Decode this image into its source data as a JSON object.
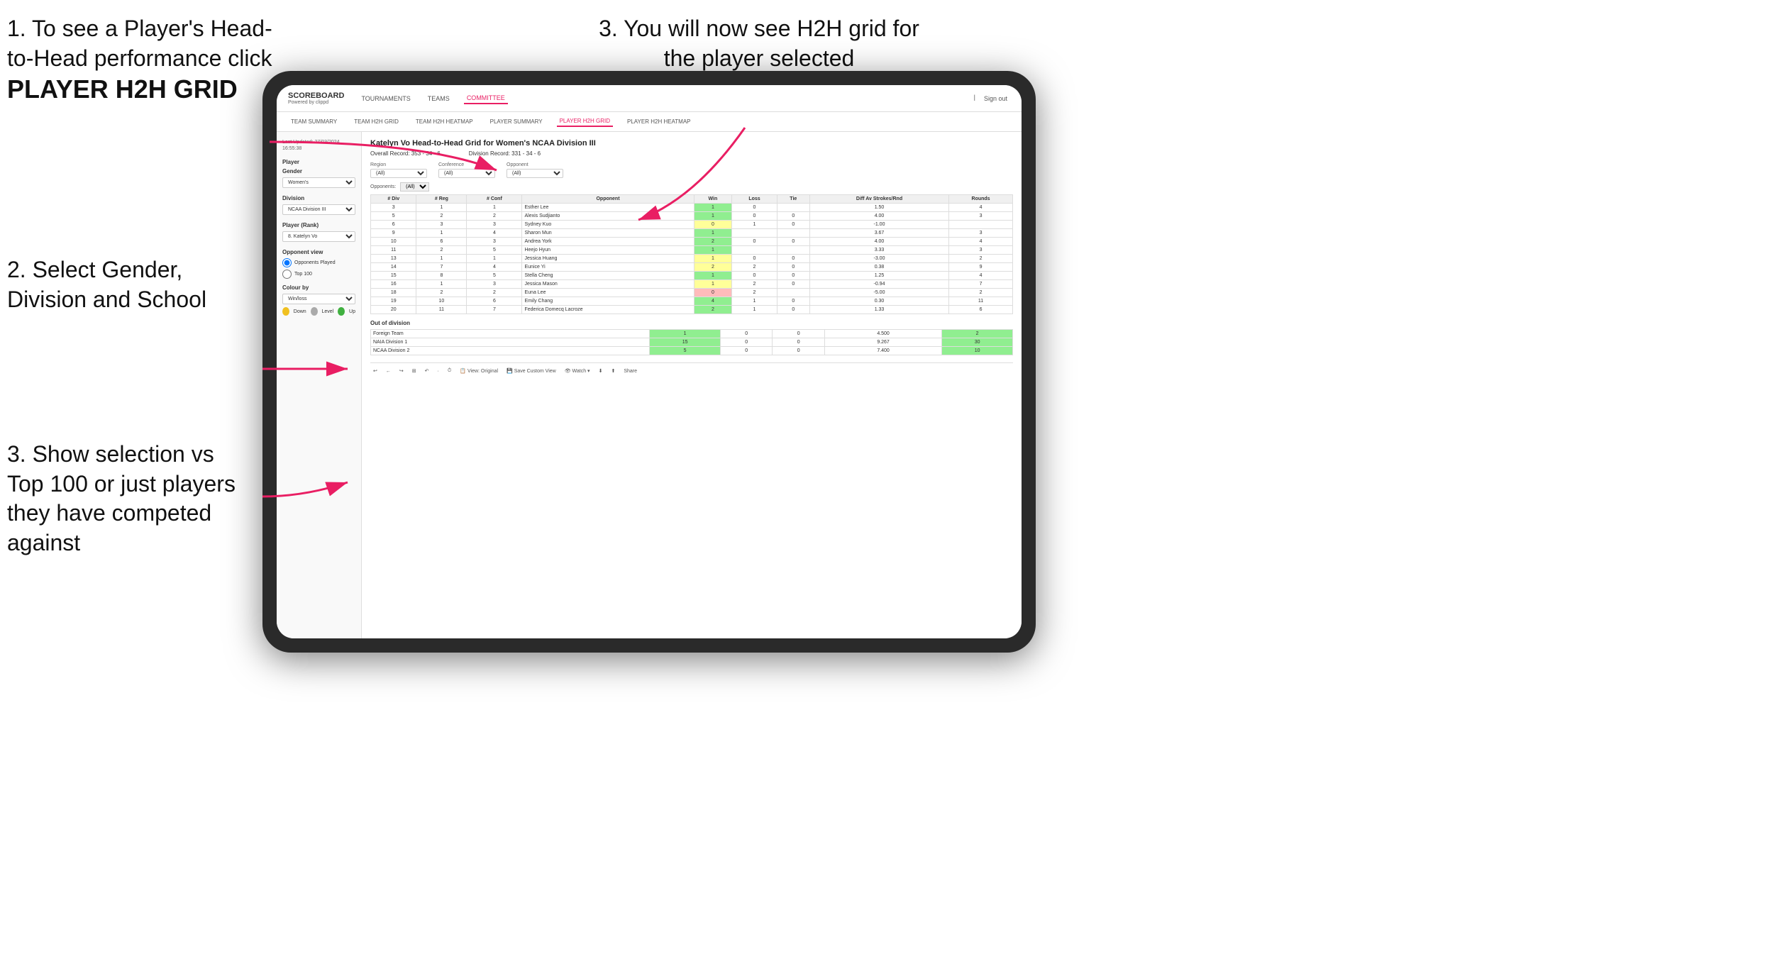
{
  "instructions": {
    "step1_title": "1. To see a Player's Head-to-Head performance click",
    "step1_bold": "PLAYER H2H GRID",
    "step2": "2. Select Gender, Division and School",
    "step3_top": "3. You will now see H2H grid for the player selected",
    "step3_bottom": "3. Show selection vs Top 100 or just players they have competed against"
  },
  "nav": {
    "logo": "SCOREBOARD",
    "logo_sub": "Powered by clippd",
    "links": [
      "TOURNAMENTS",
      "TEAMS",
      "COMMITTEE"
    ],
    "sign_out": "Sign out"
  },
  "sub_nav": {
    "links": [
      "TEAM SUMMARY",
      "TEAM H2H GRID",
      "TEAM H2H HEATMAP",
      "PLAYER SUMMARY",
      "PLAYER H2H GRID",
      "PLAYER H2H HEATMAP"
    ]
  },
  "sidebar": {
    "timestamp": "Last Updated: 27/03/2024\n16:55:38",
    "player_label": "Player",
    "gender_label": "Gender",
    "gender_value": "Women's",
    "division_label": "Division",
    "division_value": "NCAA Division III",
    "player_rank_label": "Player (Rank)",
    "player_rank_value": "8. Katelyn Vo",
    "opponent_view_label": "Opponent view",
    "opponent_options": [
      "Opponents Played",
      "Top 100"
    ],
    "colour_label": "Colour by",
    "colour_value": "Win/loss",
    "colour_dots": [
      {
        "color": "#f0c020",
        "label": "Down"
      },
      {
        "color": "#aaaaaa",
        "label": "Level"
      },
      {
        "color": "#40b040",
        "label": "Up"
      }
    ]
  },
  "grid": {
    "title": "Katelyn Vo Head-to-Head Grid for Women's NCAA Division III",
    "overall_record": "Overall Record: 353 - 34 - 6",
    "division_record": "Division Record: 331 - 34 - 6",
    "region_label": "Region",
    "conference_label": "Conference",
    "opponent_label": "Opponent",
    "opponents_label": "Opponents:",
    "filter_all": "(All)",
    "columns": [
      "# Div",
      "# Reg",
      "# Conf",
      "Opponent",
      "Win",
      "Loss",
      "Tie",
      "Diff Av Strokes/Rnd",
      "Rounds"
    ],
    "rows": [
      {
        "div": "3",
        "reg": "1",
        "conf": "1",
        "opponent": "Esther Lee",
        "win": "1",
        "loss": "0",
        "tie": "",
        "diff": "1.50",
        "rounds": "4",
        "win_color": "green"
      },
      {
        "div": "5",
        "reg": "2",
        "conf": "2",
        "opponent": "Alexis Sudjianto",
        "win": "1",
        "loss": "0",
        "tie": "0",
        "diff": "4.00",
        "rounds": "3",
        "win_color": "green"
      },
      {
        "div": "6",
        "reg": "3",
        "conf": "3",
        "opponent": "Sydney Kuo",
        "win": "0",
        "loss": "1",
        "tie": "0",
        "diff": "-1.00",
        "rounds": "",
        "win_color": "yellow"
      },
      {
        "div": "9",
        "reg": "1",
        "conf": "4",
        "opponent": "Sharon Mun",
        "win": "1",
        "loss": "",
        "tie": "",
        "diff": "3.67",
        "rounds": "3",
        "win_color": "green"
      },
      {
        "div": "10",
        "reg": "6",
        "conf": "3",
        "opponent": "Andrea York",
        "win": "2",
        "loss": "0",
        "tie": "0",
        "diff": "4.00",
        "rounds": "4",
        "win_color": "green"
      },
      {
        "div": "11",
        "reg": "2",
        "conf": "5",
        "opponent": "Heejo Hyun",
        "win": "1",
        "loss": "",
        "tie": "",
        "diff": "3.33",
        "rounds": "3",
        "win_color": "green"
      },
      {
        "div": "13",
        "reg": "1",
        "conf": "1",
        "opponent": "Jessica Huang",
        "win": "1",
        "loss": "0",
        "tie": "0",
        "diff": "-3.00",
        "rounds": "2",
        "win_color": "yellow"
      },
      {
        "div": "14",
        "reg": "7",
        "conf": "4",
        "opponent": "Eunice Yi",
        "win": "2",
        "loss": "2",
        "tie": "0",
        "diff": "0.38",
        "rounds": "9",
        "win_color": "yellow"
      },
      {
        "div": "15",
        "reg": "8",
        "conf": "5",
        "opponent": "Stella Cheng",
        "win": "1",
        "loss": "0",
        "tie": "0",
        "diff": "1.25",
        "rounds": "4",
        "win_color": "green"
      },
      {
        "div": "16",
        "reg": "1",
        "conf": "3",
        "opponent": "Jessica Mason",
        "win": "1",
        "loss": "2",
        "tie": "0",
        "diff": "-0.94",
        "rounds": "7",
        "win_color": "yellow"
      },
      {
        "div": "18",
        "reg": "2",
        "conf": "2",
        "opponent": "Euna Lee",
        "win": "0",
        "loss": "2",
        "tie": "",
        "diff": "-5.00",
        "rounds": "2",
        "win_color": "pink"
      },
      {
        "div": "19",
        "reg": "10",
        "conf": "6",
        "opponent": "Emily Chang",
        "win": "4",
        "loss": "1",
        "tie": "0",
        "diff": "0.30",
        "rounds": "11",
        "win_color": "green"
      },
      {
        "div": "20",
        "reg": "11",
        "conf": "7",
        "opponent": "Federica Domecq Lacroze",
        "win": "2",
        "loss": "1",
        "tie": "0",
        "diff": "1.33",
        "rounds": "6",
        "win_color": "green"
      }
    ],
    "out_of_division_label": "Out of division",
    "ood_rows": [
      {
        "label": "Foreign Team",
        "win": "1",
        "loss": "0",
        "tie": "0",
        "diff": "4.500",
        "rounds": "2"
      },
      {
        "label": "NAIA Division 1",
        "win": "15",
        "loss": "0",
        "tie": "0",
        "diff": "9.267",
        "rounds": "30"
      },
      {
        "label": "NCAA Division 2",
        "win": "5",
        "loss": "0",
        "tie": "0",
        "diff": "7.400",
        "rounds": "10"
      }
    ]
  },
  "toolbar": {
    "buttons": [
      "↩",
      "←",
      "↪",
      "⊞",
      "↶",
      "·",
      "⏱",
      "View: Original",
      "Save Custom View",
      "👁 Watch ▾",
      "⬇",
      "⬆",
      "Share"
    ]
  }
}
